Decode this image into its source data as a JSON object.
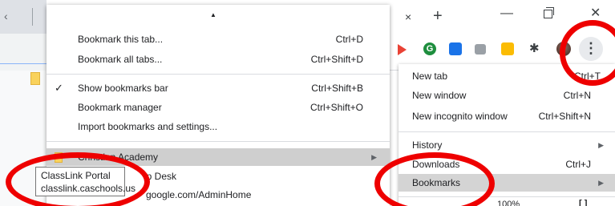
{
  "browser": {
    "new_tab_symbol": "+",
    "close_tab_symbol": "×",
    "minimize_symbol": "—",
    "close_window_symbol": "✕",
    "menu_symbol": "⋮",
    "back_symbol": "‹",
    "extension_green_letter": "G",
    "partial_url": "google.com/AdminHome"
  },
  "main_menu": {
    "items": [
      {
        "label": "New tab",
        "shortcut": "Ctrl+T"
      },
      {
        "label": "New window",
        "shortcut": "Ctrl+N"
      },
      {
        "label": "New incognito window",
        "shortcut": "Ctrl+Shift+N"
      },
      {
        "label": "History"
      },
      {
        "label": "Downloads",
        "shortcut": "Ctrl+J"
      },
      {
        "label": "Bookmarks"
      }
    ],
    "zoom_value": "100%",
    "fullscreen_symbol": "[ ]"
  },
  "bookmarks_menu": {
    "items": [
      {
        "label": "Bookmark this tab...",
        "shortcut": "Ctrl+D"
      },
      {
        "label": "Bookmark all tabs...",
        "shortcut": "Ctrl+Shift+D"
      },
      {
        "label": "Show bookmarks bar",
        "shortcut": "Ctrl+Shift+B",
        "checked": true
      },
      {
        "label": "Bookmark manager",
        "shortcut": "Ctrl+Shift+O"
      },
      {
        "label": "Import bookmarks and settings..."
      },
      {
        "label": "Christian Academy"
      },
      {
        "label": "lp Desk"
      },
      {
        "label": "google.com/AdminHome"
      }
    ]
  },
  "tooltip": {
    "title": "ClassLink Portal",
    "url": "classlink.caschools.us"
  },
  "colors": {
    "annotation": "#ee0000",
    "highlight": "#d4d4d4",
    "folder": "#f9d25c"
  }
}
